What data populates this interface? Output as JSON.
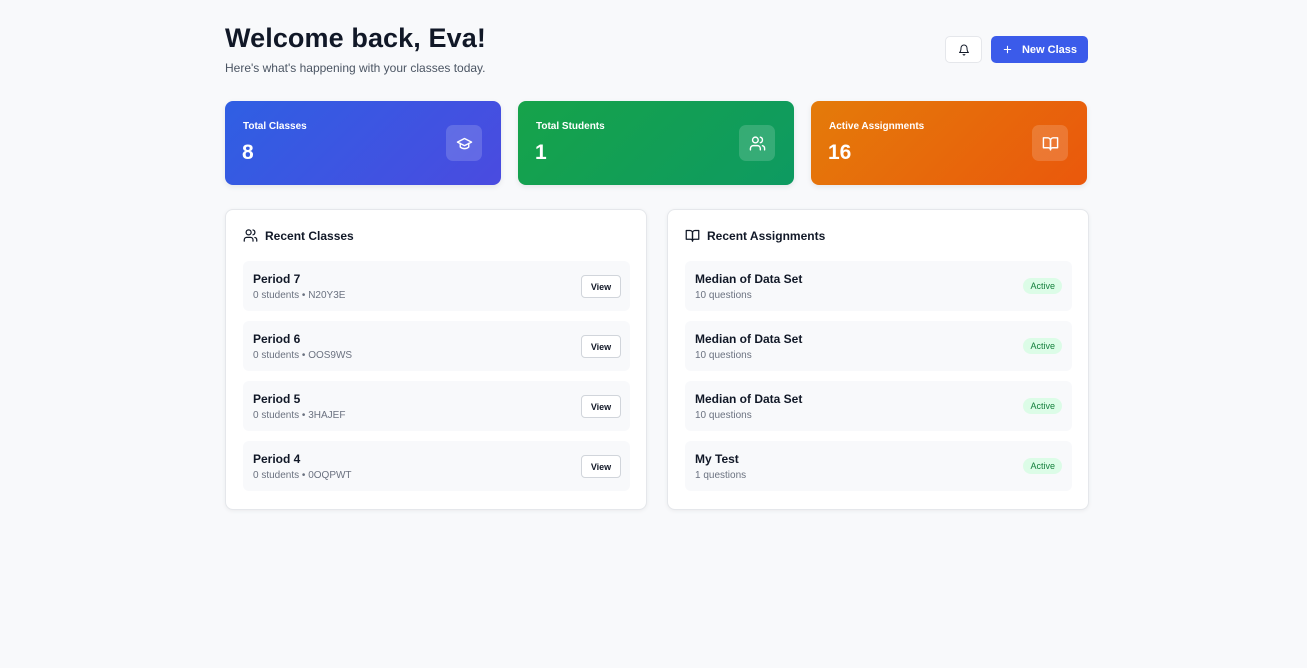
{
  "header": {
    "title": "Welcome back, Eva!",
    "subtitle": "Here's what's happening with your classes today.",
    "new_class_label": "New Class"
  },
  "stats": [
    {
      "label": "Total Classes",
      "value": "8",
      "icon": "graduation-cap-icon",
      "color": "#3b5bea"
    },
    {
      "label": "Total Students",
      "value": "1",
      "icon": "users-icon",
      "color": "#16a34a"
    },
    {
      "label": "Active Assignments",
      "value": "16",
      "icon": "book-open-icon",
      "color": "#ea580c"
    }
  ],
  "recent_classes": {
    "title": "Recent Classes",
    "view_label": "View",
    "items": [
      {
        "name": "Period 7",
        "details": "0 students • N20Y3E"
      },
      {
        "name": "Period 6",
        "details": "0 students • OOS9WS"
      },
      {
        "name": "Period 5",
        "details": "0 students • 3HAJEF"
      },
      {
        "name": "Period 4",
        "details": "0 students • 0OQPWT"
      }
    ]
  },
  "recent_assignments": {
    "title": "Recent Assignments",
    "items": [
      {
        "name": "Median of Data Set",
        "details": "10 questions",
        "status": "Active"
      },
      {
        "name": "Median of Data Set",
        "details": "10 questions",
        "status": "Active"
      },
      {
        "name": "Median of Data Set",
        "details": "10 questions",
        "status": "Active"
      },
      {
        "name": "My Test",
        "details": "1 questions",
        "status": "Active"
      }
    ]
  }
}
